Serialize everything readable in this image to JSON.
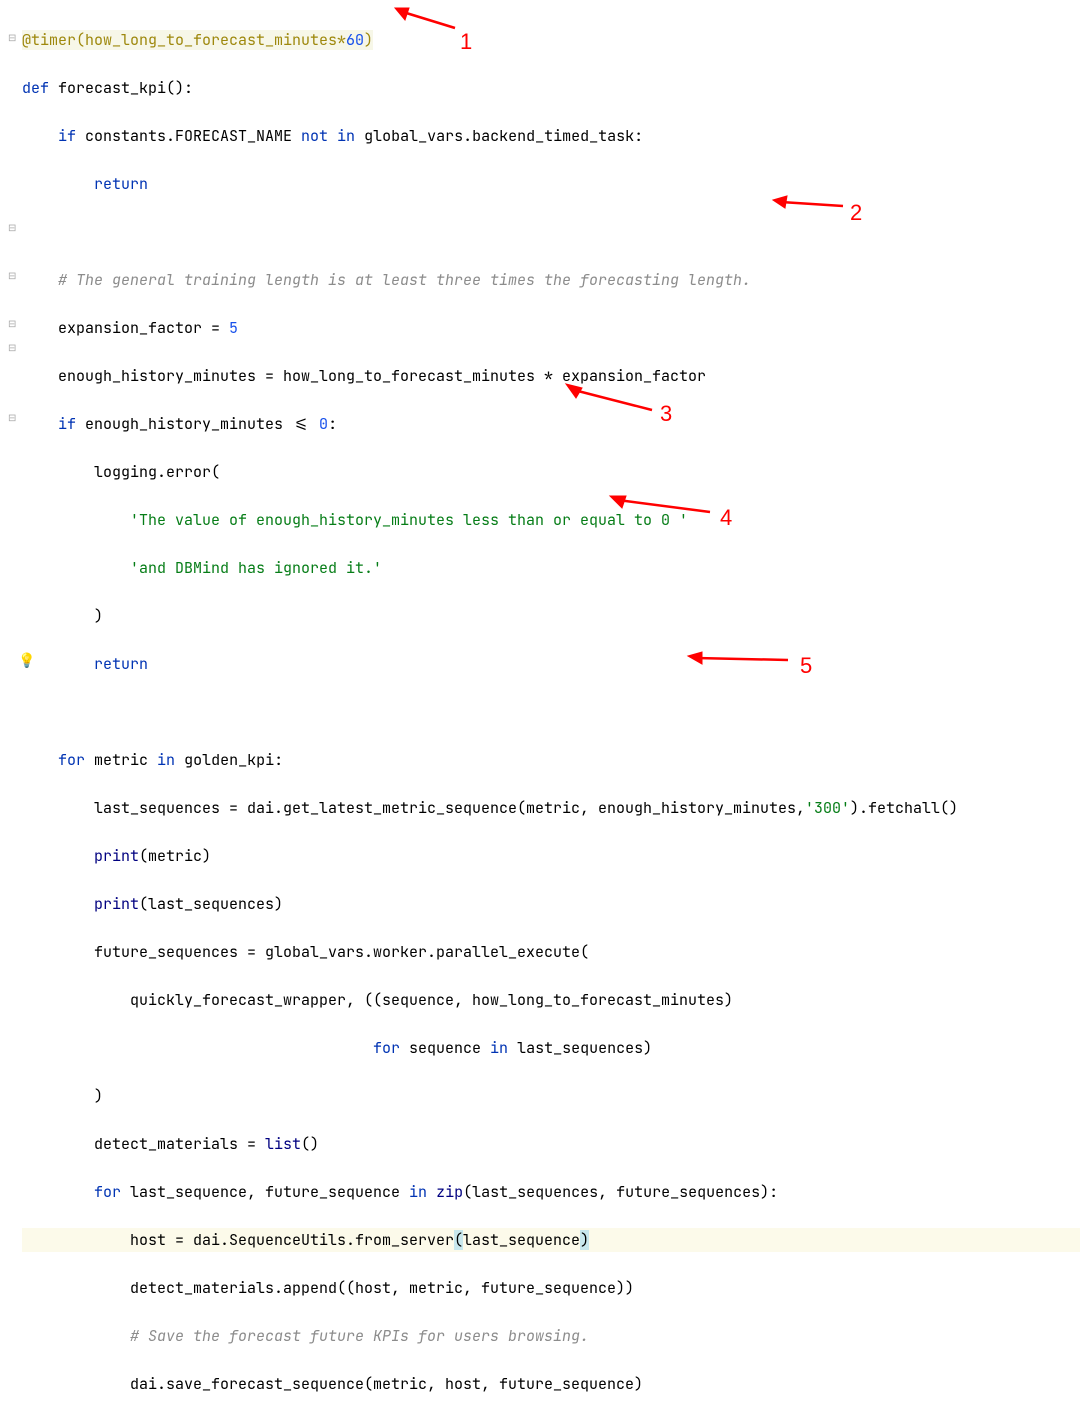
{
  "annotations": {
    "a1": "1",
    "a2": "2",
    "a3": "3",
    "a4": "4",
    "a5": "5"
  },
  "code": {
    "l01_decorator": "@timer",
    "l01_rest_open": "(how_long_to_forecast_minutes*",
    "l01_num": "60",
    "l01_rest_close": ")",
    "l02_def": "def",
    "l02_name": " forecast_kpi():",
    "l03_if": "if",
    "l03_mid": " constants.FORECAST_NAME ",
    "l03_notin": "not in",
    "l03_end": " global_vars.backend_timed_task:",
    "l04_return": "return",
    "l06_comment": "# The general training length is at least three times the forecasting length.",
    "l07_a": "expansion_factor = ",
    "l07_num": "5",
    "l08": "enough_history_minutes = how_long_to_forecast_minutes * expansion_factor",
    "l09_if": "if",
    "l09_rest": " enough_history_minutes <= ",
    "l09_num": "0",
    "l09_colon": ":",
    "l10": "logging.error(",
    "l11_str": "'The value of enough_history_minutes less than or equal to 0 '",
    "l12_str": "'and DBMind has ignored it.'",
    "l13": ")",
    "l14_return": "return",
    "l16_for": "for",
    "l16_mid": " metric ",
    "l16_in": "in",
    "l16_end": " golden_kpi:",
    "l17_a": "last_sequences = dai.get_latest_metric_sequence(metric, enough_history_minutes,",
    "l17_str": "'300'",
    "l17_b": ").fetchall()",
    "l18_print": "print",
    "l18_rest": "(metric)",
    "l19_print": "print",
    "l19_rest": "(last_sequences)",
    "l20": "future_sequences = global_vars.worker.parallel_execute(",
    "l21": "quickly_forecast_wrapper, ((sequence, how_long_to_forecast_minutes)",
    "l22_for": "for",
    "l22_mid": " sequence ",
    "l22_in": "in",
    "l22_end": " last_sequences)",
    "l23": ")",
    "l24_a": "detect_materials = ",
    "l24_list": "list",
    "l24_b": "()",
    "l25_for": "for",
    "l25_mid": " last_sequence, future_sequence ",
    "l25_in": "in",
    "l25_zip": "zip",
    "l25_end": "(last_sequences, future_sequences):",
    "l26_a": "host = dai.SequenceUtils.from_server",
    "l26_hl1": "(",
    "l26_mid": "last_sequence",
    "l26_hl2": ")",
    "l27": "detect_materials.append((host, metric, future_sequence))",
    "l28_comment": "# Save the forecast future KPIs for users browsing.",
    "l29": "dai.save_forecast_sequence(metric, host, future_sequence)"
  }
}
